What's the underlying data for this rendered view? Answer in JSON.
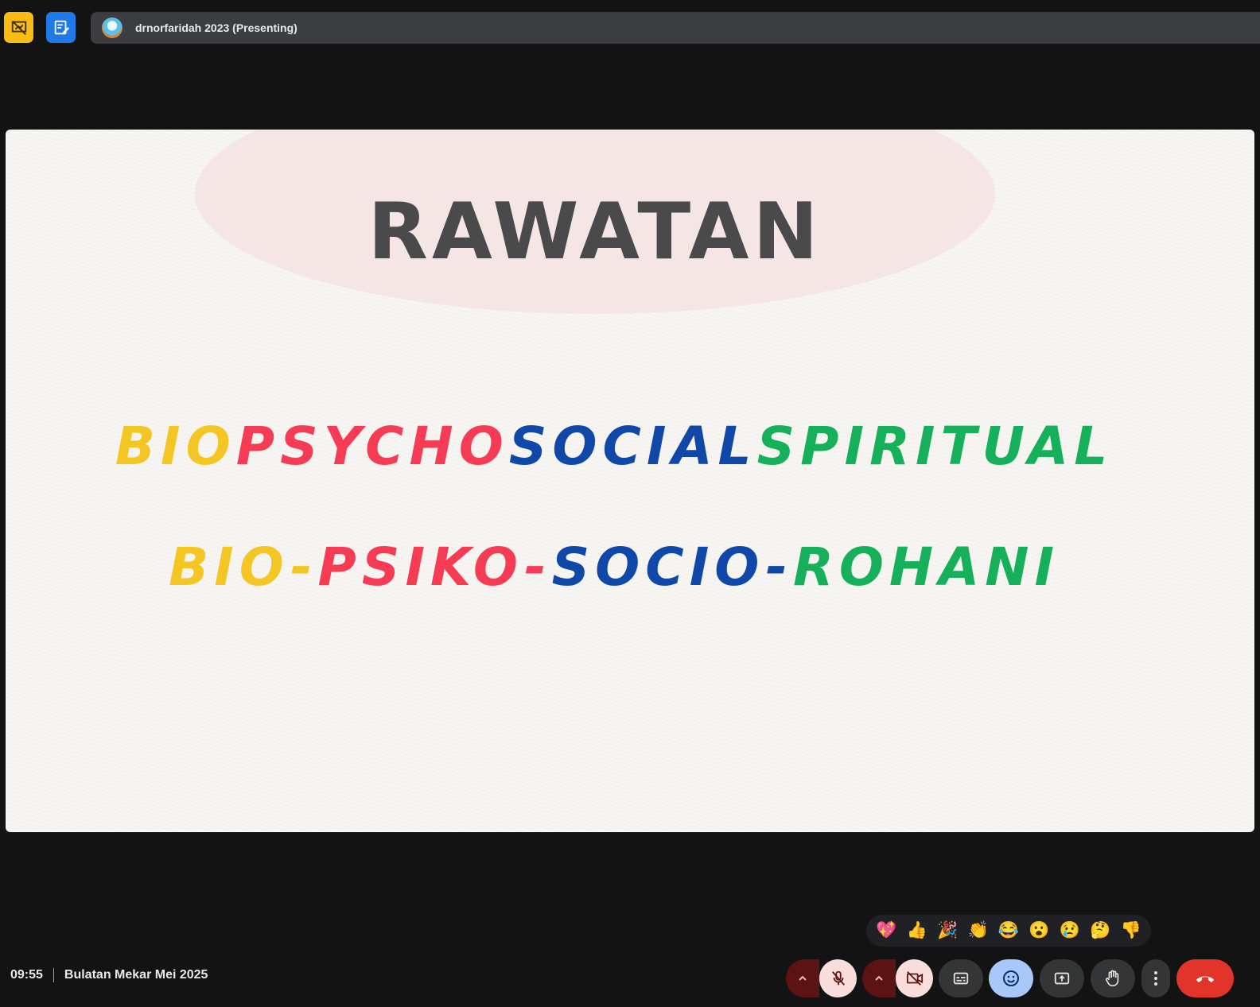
{
  "top": {
    "presenter_label": "drnorfaridah 2023 (Presenting)"
  },
  "slide": {
    "title": "RAWATAN",
    "line1": [
      {
        "text": "BIO",
        "color": "#f4c624"
      },
      {
        "text": "PSYCHO",
        "color": "#f63b54"
      },
      {
        "text": "SOCIAL",
        "color": "#0f48a8"
      },
      {
        "text": "SPIRITUAL",
        "color": "#17b05a"
      }
    ],
    "line2": [
      {
        "text": "BIO-",
        "color": "#f4c624"
      },
      {
        "text": "PSIKO-",
        "color": "#f63b54"
      },
      {
        "text": "SOCIO-",
        "color": "#0f48a8"
      },
      {
        "text": "ROHANI",
        "color": "#17b05a"
      }
    ]
  },
  "reactions": [
    "💖",
    "👍",
    "🎉",
    "👏",
    "😂",
    "😮",
    "😢",
    "🤔",
    "👎"
  ],
  "bottom": {
    "time": "09:55",
    "meeting_title": "Bulatan Mekar Mei 2025"
  },
  "colors": {
    "leave": "#e2342a",
    "emoji_active": "#a8c7fa",
    "muted_bg": "#f9dedc"
  }
}
